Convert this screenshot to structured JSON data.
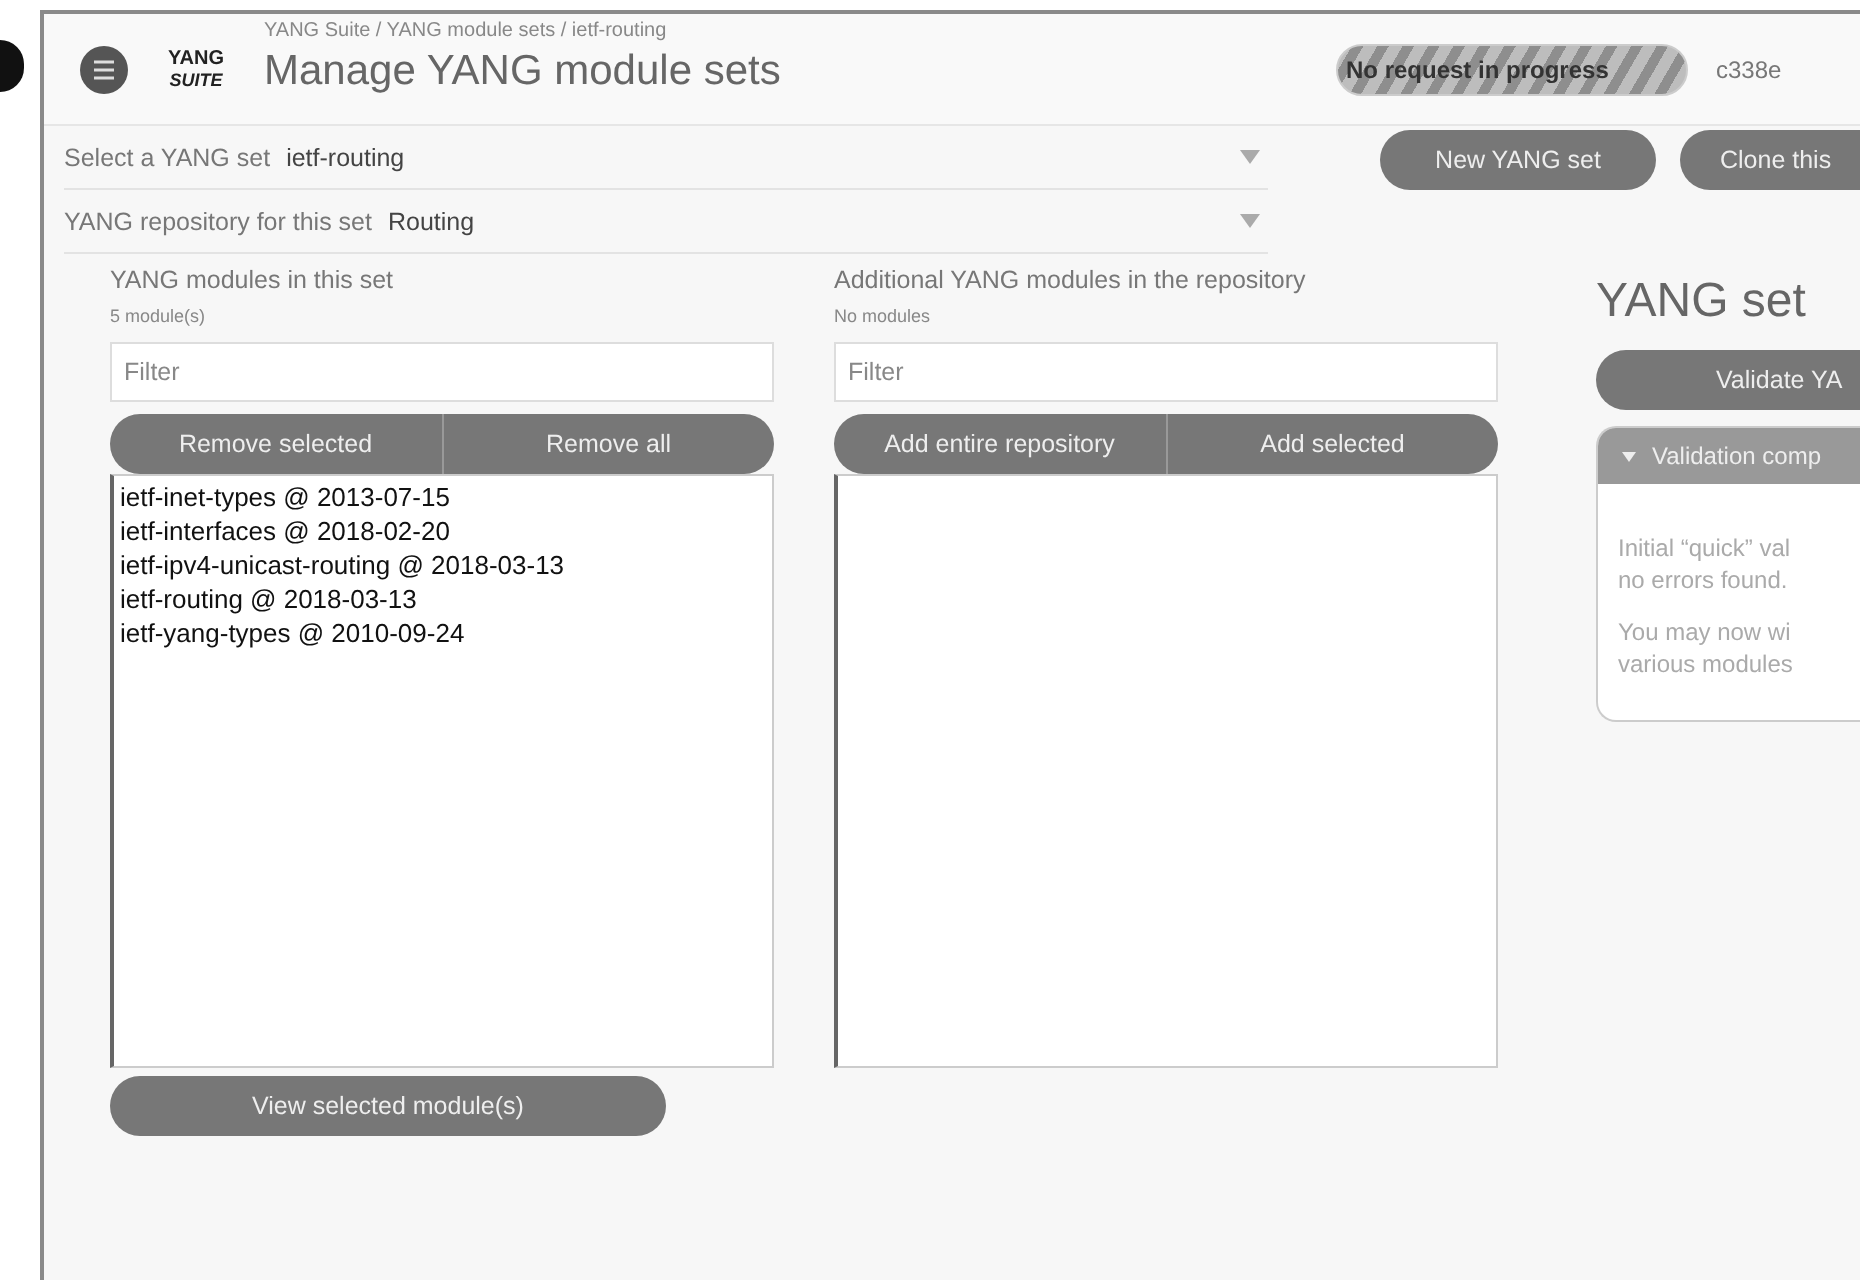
{
  "breadcrumb": "YANG Suite / YANG module sets / ietf-routing",
  "logo": {
    "line_1": "YANG",
    "line_2": "SUITE"
  },
  "title": "Manage YANG module sets",
  "status_pill": "No request in progress",
  "user": "c338e",
  "selectors": [
    {
      "label": "Select a YANG set",
      "value": "ietf-routing"
    },
    {
      "label": "YANG repository for this set",
      "value": "Routing"
    }
  ],
  "header_buttons": [
    "New YANG set",
    "Clone this"
  ],
  "panels": [
    {
      "title": "YANG modules in this set",
      "count": "5 module(s)",
      "filter": {
        "placeholder": "Filter"
      },
      "actions": [
        "Remove selected",
        "Remove all"
      ],
      "modules": [
        "ietf-inet-types @ 2013-07-15",
        "ietf-interfaces @ 2018-02-20",
        "ietf-ipv4-unicast-routing @ 2018-03-13",
        "ietf-routing @ 2018-03-13",
        "ietf-yang-types @ 2010-09-24"
      ],
      "footer_button": "View selected module(s)"
    },
    {
      "title": "Additional YANG modules in the repository",
      "count": "No modules",
      "filter": {
        "placeholder": "Filter"
      },
      "actions": [
        "Add entire repository",
        "Add selected"
      ]
    }
  ],
  "validation": {
    "title": "YANG set",
    "button": "Validate YA",
    "section": {
      "title": "Validation comp",
      "expanded": true,
      "paragraphs": [
        [
          "Initial “quick” val",
          "no errors found."
        ],
        [
          "You may now wi",
          "various modules"
        ]
      ]
    }
  }
}
